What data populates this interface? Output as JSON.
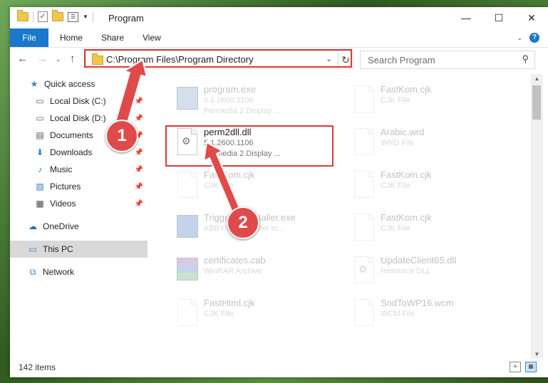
{
  "window": {
    "title": "Program"
  },
  "ribbon": {
    "file": "File",
    "home": "Home",
    "share": "Share",
    "view": "View"
  },
  "address": {
    "path": "C:\\Program Files\\Program Directory"
  },
  "search": {
    "placeholder": "Search Program"
  },
  "sidebar": {
    "items": [
      {
        "label": "Quick access",
        "icon": "star-icon"
      },
      {
        "label": "Local Disk (C:)",
        "icon": "drive-icon",
        "pinned": true
      },
      {
        "label": "Local Disk (D:)",
        "icon": "drive-icon",
        "pinned": true
      },
      {
        "label": "Documents",
        "icon": "documents-icon",
        "pinned": true
      },
      {
        "label": "Downloads",
        "icon": "download-icon",
        "pinned": true
      },
      {
        "label": "Music",
        "icon": "music-icon",
        "pinned": true
      },
      {
        "label": "Pictures",
        "icon": "pictures-icon",
        "pinned": true
      },
      {
        "label": "Videos",
        "icon": "videos-icon",
        "pinned": true
      },
      {
        "label": "OneDrive",
        "icon": "cloud-icon"
      },
      {
        "label": "This PC",
        "icon": "computer-icon",
        "selected": true
      },
      {
        "label": "Network",
        "icon": "network-icon"
      }
    ]
  },
  "files": [
    {
      "name": "program.exe",
      "line1": "5.1.2600.1106",
      "line2": "Permedia 2 Display ...",
      "icon": "exe-icon"
    },
    {
      "name": "FastKom.cjk",
      "line1": "CJK File",
      "line2": "",
      "icon": "document-icon"
    },
    {
      "name": "perm2dll.dll",
      "line1": "5.1.2600.1106",
      "line2": "Permedia 2 Display ...",
      "icon": "dll-gear-icon"
    },
    {
      "name": "Arabic.wrd",
      "line1": "WRD File",
      "line2": "",
      "icon": "document-icon"
    },
    {
      "name": "FastKom.cjk",
      "line1": "CJK File",
      "line2": "",
      "icon": "document-icon"
    },
    {
      "name": "FastKom.cjk",
      "line1": "CJK File",
      "line2": "",
      "icon": "document-icon"
    },
    {
      "name": "Trigger.Uninstaller.exe",
      "line1": "ABBYY Uninstaller tri...",
      "line2": "",
      "icon": "app-icon"
    },
    {
      "name": "FastKom.cjk",
      "line1": "CJK File",
      "line2": "",
      "icon": "document-icon"
    },
    {
      "name": "certificates.cab",
      "line1": "WinRAR Archive",
      "line2": "",
      "icon": "archive-icon"
    },
    {
      "name": "UpdateClient65.dll",
      "line1": "Resource DLL",
      "line2": "",
      "icon": "dll-gear-icon"
    },
    {
      "name": "FastHtml.cjk",
      "line1": "CJK File",
      "line2": "",
      "icon": "document-icon"
    },
    {
      "name": "SndToWP16.wcm",
      "line1": "WCM File",
      "line2": "",
      "icon": "document-icon"
    }
  ],
  "status": {
    "count": "142 items"
  },
  "annotations": {
    "step1": "1",
    "step2": "2",
    "color": "#e14a4a"
  }
}
